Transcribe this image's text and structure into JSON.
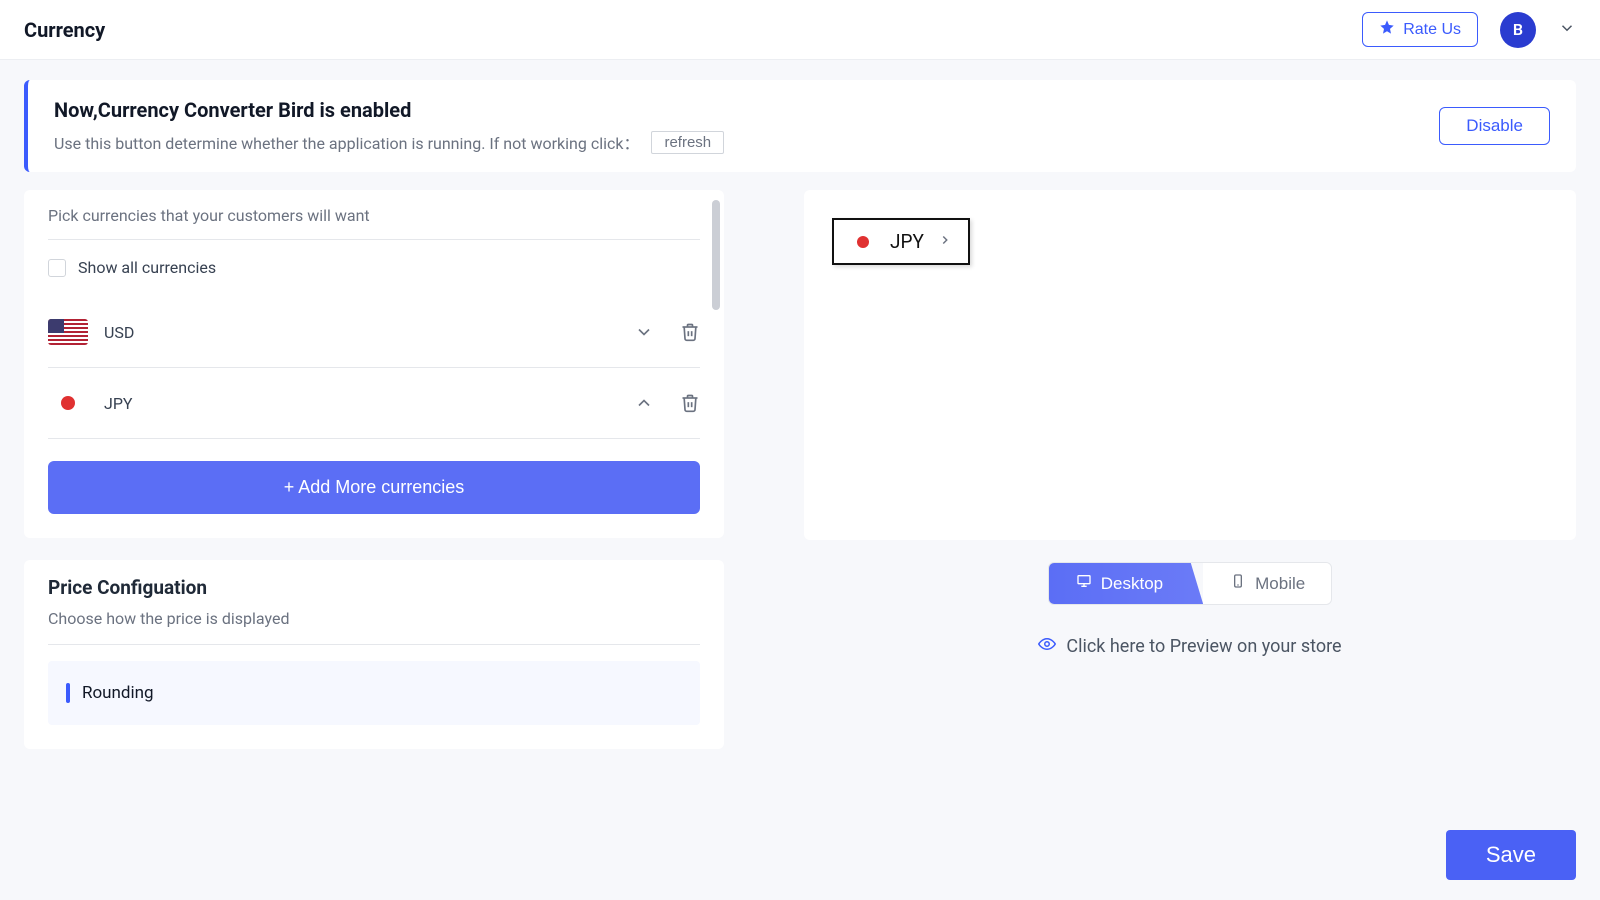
{
  "header": {
    "title": "Currency",
    "rate_label": "Rate Us",
    "avatar_letter": "B"
  },
  "status": {
    "title": "Now,Currency Converter Bird is enabled",
    "subtitle": "Use this button determine whether the application is running.  If not working click：",
    "refresh_label": "refresh",
    "disable_label": "Disable"
  },
  "currencies": {
    "pick_label": "Pick currencies that your customers will want",
    "show_all_label": "Show all currencies",
    "items": [
      {
        "code": "USD",
        "flag": "us",
        "dir": "down"
      },
      {
        "code": "JPY",
        "flag": "jp",
        "dir": "up"
      }
    ],
    "add_label": "+ Add More currencies"
  },
  "price": {
    "title": "Price Configuation",
    "subtitle": "Choose how the price is displayed",
    "rounding_label": "Rounding"
  },
  "preview": {
    "currency_code": "JPY",
    "desktop_label": "Desktop",
    "mobile_label": "Mobile",
    "link_label": "Click here to Preview on your store"
  },
  "footer": {
    "save_label": "Save"
  }
}
